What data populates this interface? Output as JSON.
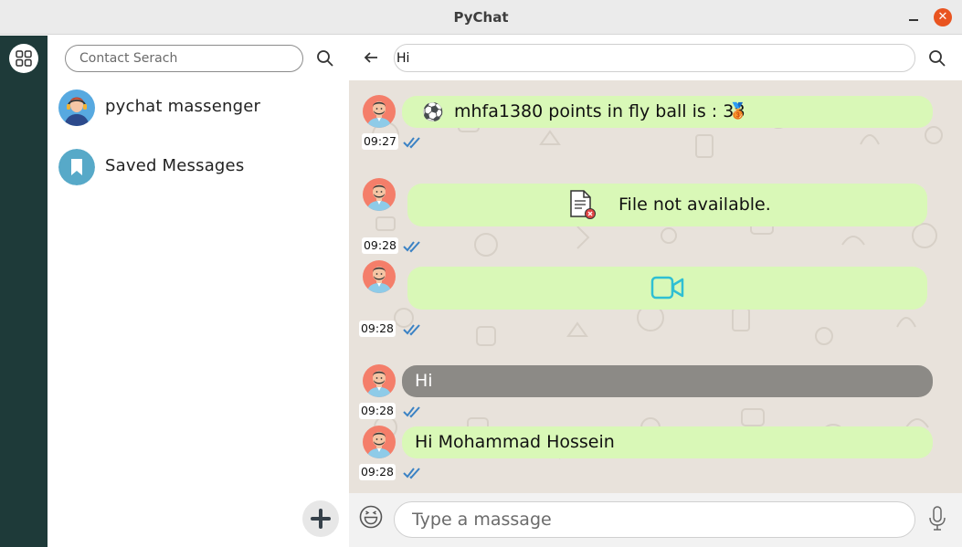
{
  "window": {
    "title": "PyChat"
  },
  "sidebar": {
    "menu_icon": "grid-menu-icon"
  },
  "contacts": {
    "search_placeholder": "Contact Serach",
    "items": [
      {
        "name": "pychat massenger",
        "icon": "support-agent-avatar"
      },
      {
        "name": "Saved Messages",
        "icon": "bookmark-icon"
      }
    ],
    "add_icon": "plus-icon"
  },
  "chat": {
    "search_value": "Hi",
    "messages": [
      {
        "type": "game",
        "emoji": "⚽",
        "text": "mhfa1380 points in fly ball is : 38",
        "badge": "🥉",
        "time": "09:27",
        "status": "read"
      },
      {
        "type": "file",
        "text": "File not available.",
        "icon": "file-error-icon",
        "time": "09:28",
        "status": "read"
      },
      {
        "type": "video",
        "icon": "video-camera-icon",
        "time": "09:28",
        "status": "read"
      },
      {
        "type": "text",
        "text": "Hi",
        "style": "gray",
        "time": "09:28",
        "status": "read"
      },
      {
        "type": "text",
        "text": "Hi Mohammad Hossein",
        "time": "09:28",
        "status": "read"
      }
    ]
  },
  "composer": {
    "placeholder": "Type a massage",
    "emoji_icon": "emoji-icon",
    "mic_icon": "microphone-icon"
  },
  "colors": {
    "bubble": "#d9f8b7",
    "bubble_gray": "#8c8a86",
    "chat_bg": "#e8e2db",
    "rail": "#1e3a39",
    "close": "#e95420"
  }
}
